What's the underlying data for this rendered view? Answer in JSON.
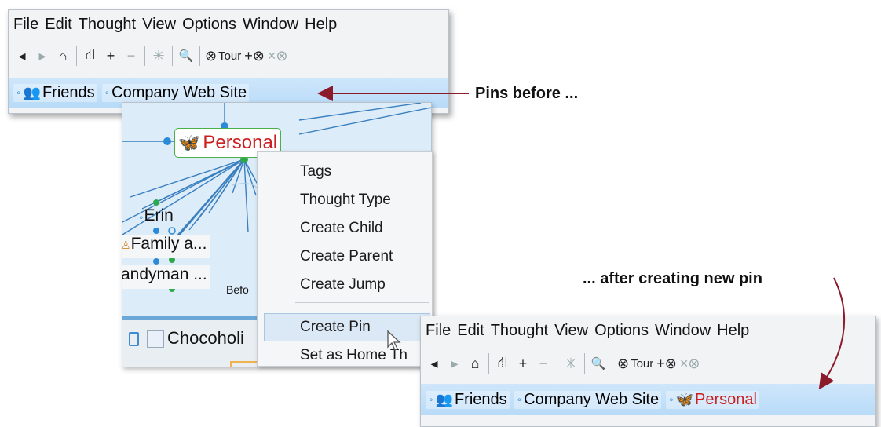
{
  "menu": [
    "File",
    "Edit",
    "Thought",
    "View",
    "Options",
    "Window",
    "Help"
  ],
  "toolbar": {
    "back_icon": "◂",
    "forward_icon": "▸",
    "home_icon": "⌂",
    "network_icon": "⛙",
    "add_icon": "+",
    "remove_icon": "−",
    "layout_icon": "✳",
    "search_icon": "🔍",
    "tour_icon": "⊗",
    "tour_label": "Tour",
    "add_tour_icon": "+⊗",
    "close_tour_icon": "×⊗"
  },
  "pins_before": [
    {
      "label": "Friends",
      "icon": "👥"
    },
    {
      "label": "Company Web Site",
      "icon": ""
    }
  ],
  "pins_after": [
    {
      "label": "Friends",
      "icon": "👥"
    },
    {
      "label": "Company Web Site",
      "icon": ""
    },
    {
      "label": "Personal",
      "icon": "🦋"
    }
  ],
  "map": {
    "active_thought": "Personal",
    "active_thought_icon": "🦋",
    "nodes": [
      "Erin",
      "Family a...",
      "andyman ...",
      "Befo"
    ],
    "bottom_thought": "Chocoholi"
  },
  "context_menu": {
    "items": [
      "Tags",
      "Thought Type",
      "Create Child",
      "Create Parent",
      "Create Jump",
      "Create Pin",
      "Set as Home Th"
    ],
    "highlighted": "Create Pin"
  },
  "annotations": {
    "before": "Pins before ...",
    "after": "... after creating new pin"
  },
  "colors": {
    "arrow": "#8b1a2b",
    "personal_text": "#cc1f1f",
    "pin_bar": "#c3e0f9"
  }
}
